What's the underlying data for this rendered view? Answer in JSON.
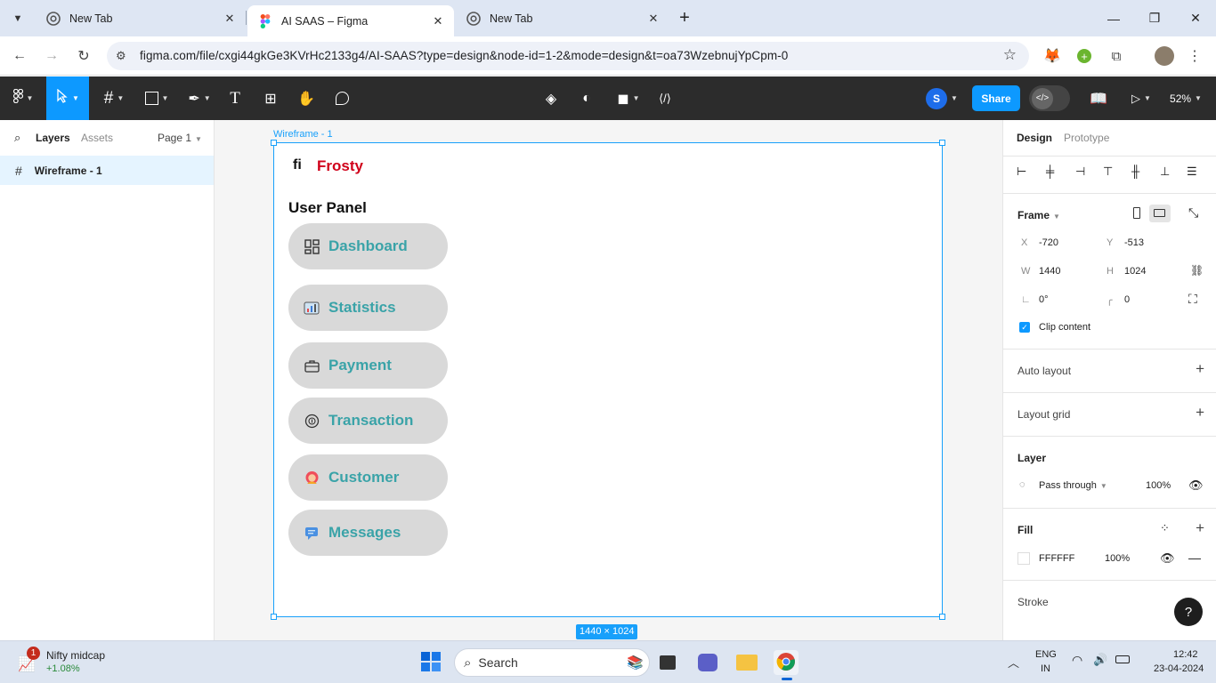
{
  "browser": {
    "tabs": [
      {
        "title": "New Tab",
        "active": false
      },
      {
        "title": "AI SAAS – Figma",
        "active": true
      },
      {
        "title": "New Tab",
        "active": false
      }
    ],
    "new_tab_symbol": "+",
    "close_symbol": "✕",
    "url": "figma.com/file/cxgi44gkGe3KVrHc2133g4/AI-SAAS?type=design&node-id=1-2&mode=design&t=oa73WzebnujYpCpm-0"
  },
  "figma_toolbar": {
    "share_label": "Share",
    "user_initial": "S",
    "zoom": "52%"
  },
  "left_panel": {
    "tabs": [
      "Layers",
      "Assets"
    ],
    "page": "Page 1",
    "layer_item": "Wireframe - 1"
  },
  "canvas": {
    "frame_label": "Wireframe - 1",
    "frame_size": "1440 × 1024",
    "logo_mark": "fi",
    "brand": "Frosty",
    "brand_color": "#d0021b",
    "section_title": "User Panel",
    "nav_items": [
      {
        "label": "Dashboard",
        "icon": "grid-icon"
      },
      {
        "label": "Statistics",
        "icon": "statistics-icon"
      },
      {
        "label": "Payment",
        "icon": "briefcase-icon"
      },
      {
        "label": "Transaction",
        "icon": "transaction-icon"
      },
      {
        "label": "Customer",
        "icon": "customer-icon"
      },
      {
        "label": "Messages",
        "icon": "message-icon"
      }
    ],
    "nav_text_color": "#3aa3a8"
  },
  "right_panel": {
    "tabs": [
      "Design",
      "Prototype"
    ],
    "frame_title": "Frame",
    "x_label": "X",
    "x": "-720",
    "y_label": "Y",
    "y": "-513",
    "w_label": "W",
    "w": "1440",
    "h_label": "H",
    "h": "1024",
    "rotation": "0°",
    "radius": "0",
    "clip_content": "Clip content",
    "auto_layout": "Auto layout",
    "layout_grid": "Layout grid",
    "layer_title": "Layer",
    "blend_mode": "Pass through",
    "layer_opacity": "100%",
    "fill_title": "Fill",
    "fill_hex": "FFFFFF",
    "fill_opacity": "100%",
    "stroke_title": "Stroke",
    "help": "?"
  },
  "taskbar": {
    "widget_title": "Nifty midcap",
    "widget_value": "+1.08%",
    "widget_badge": "1",
    "search_label": "Search",
    "lang_top": "ENG",
    "lang_bottom": "IN",
    "time": "12:42",
    "date": "23-04-2024"
  }
}
